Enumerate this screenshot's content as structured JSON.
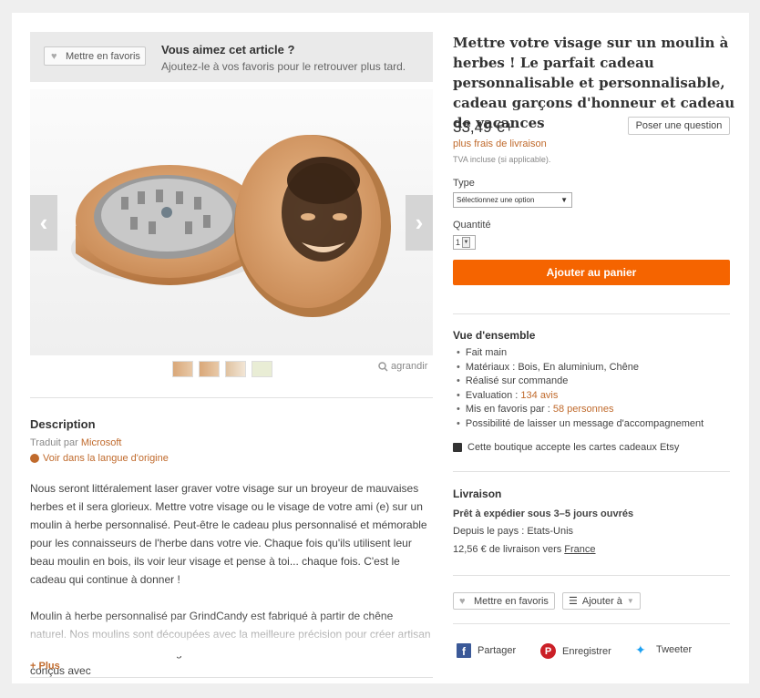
{
  "favorites_banner": {
    "button_label": "Mettre en favoris",
    "title": "Vous aimez cet article ?",
    "subtitle": "Ajoutez-le à vos favoris pour le retrouver plus tard."
  },
  "gallery": {
    "prev_icon": "‹",
    "next_icon": "›",
    "zoom_label": "agrandir"
  },
  "description": {
    "title": "Description",
    "translated_prefix": "Traduit par ",
    "translator": "Microsoft",
    "original_language_link": "Voir dans la langue d'origine",
    "paragraphs": [
      "Nous seront littéralement laser graver votre visage sur un broyeur de mauvaises herbes et il sera glorieux. Mettre votre visage ou le visage de votre ami (e) sur un moulin à herbe personnalisé. Peut-être le cadeau plus personnalisé et mémorable pour les connaisseurs de l'herbe dans votre vie. Chaque fois qu'ils utilisent leur beau moulin en bois, ils voir leur visage et pense à toi... chaque fois. C'est le cadeau qui continue à donner !",
      "Moulin à herbe personnalisé par GrindCandy est fabriqué à partir de chêne naturel. Nos moulins sont découpées avec la meilleure précision pour créer artisan dessins et modèles sur le visage le moulin bois au laser. Nos moulins à bois sont conçus avec"
    ],
    "more_label": "+ Plus"
  },
  "product": {
    "title": "Mettre votre visage sur un moulin à herbes ! Le parfait cadeau personnalisable et personnalisable, cadeau garçons d'honneur et cadeau de vacances",
    "price": "33,49 €+",
    "ask_question": "Poser une question",
    "shipping_note": "plus frais de livraison",
    "vat_note": "TVA incluse (si applicable).",
    "type_label": "Type",
    "type_selected": "Sélectionnez une option",
    "quantity_label": "Quantité",
    "quantity_selected": "1",
    "add_to_cart": "Ajouter au panier"
  },
  "overview": {
    "title": "Vue d'ensemble",
    "items": {
      "handmade": "Fait main",
      "materials": "Matériaux : Bois, En aluminium, Chêne",
      "made_to_order": "Réalisé sur commande",
      "rating_prefix": "Evaluation : ",
      "rating_value": "134 avis",
      "favorited_prefix": "Mis en favoris par : ",
      "favorited_value": "58 personnes",
      "message": "Possibilité de laisser un message d'accompagnement"
    },
    "gift_cards": "Cette boutique accepte les cartes cadeaux Etsy"
  },
  "shipping": {
    "title": "Livraison",
    "ready": "Prêt à expédier sous 3–5 jours ouvrés",
    "from": "Depuis le pays : Etats-Unis",
    "cost_prefix": "12,56 € de livraison vers ",
    "destination": "France"
  },
  "actions": {
    "favorite": "Mettre en favoris",
    "add_to": "Ajouter à"
  },
  "share": {
    "facebook": "Partager",
    "pinterest": "Enregistrer",
    "twitter": "Tweeter"
  },
  "colors": {
    "accent": "#f56400",
    "link": "#c06a2c"
  }
}
